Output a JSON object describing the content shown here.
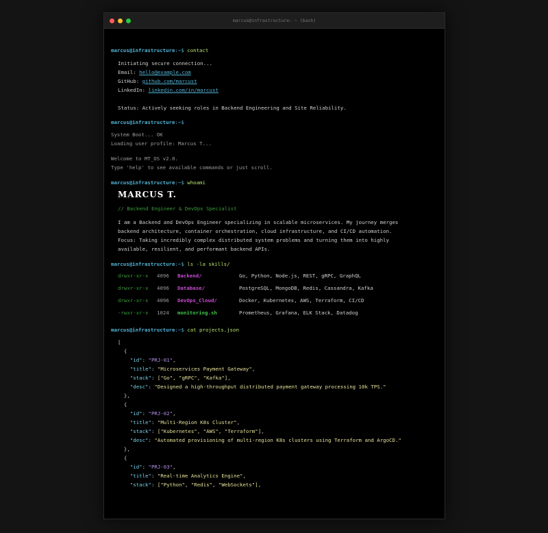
{
  "window": {
    "title": "marcus@infrastructure: ~ (bash)"
  },
  "prompt": {
    "user": "marcus@infrastructure",
    "path": ":~$"
  },
  "sections": {
    "contact": {
      "command": " contact",
      "lines": [
        "Initiating secure connection..."
      ],
      "email_label": "Email: ",
      "email": "hello@example.com",
      "github_label": "GitHub: ",
      "github": "github.com/marcust",
      "linkedin_label": "LinkedIn: ",
      "linkedin": "linkedin.com/in/marcust",
      "status": "Status: Actively seeking roles in Backend Engineering and Site Reliability."
    },
    "boot": {
      "command": "",
      "line1": "System Boot... OK",
      "line2": "Loading user profile: Marcus T...",
      "line3": "Welcome to MT_OS v2.0.",
      "line4": "Type 'help' to see available commands or just scroll."
    },
    "whoami": {
      "command": " whoami",
      "name": "MARCUS T.",
      "subtitle": "// Backend Engineer & DevOps Specialist",
      "bio": [
        "I am a Backend and DevOps Engineer specializing in scalable microservices. My journey merges",
        "backend architecture, container orchestration, cloud infrastructure, and CI/CD automation.",
        "Focus: Taking incredibly complex distributed system problems and turning them into highly",
        "available, resilient, and performant backend APIs."
      ]
    },
    "skills": {
      "command": " ls -la skills/",
      "rows": [
        {
          "perm": "drwxr-xr-x",
          "size": "4096",
          "name": "Backend/",
          "desc": "Go, Python, Node.js, REST, gRPC, GraphQL"
        },
        {
          "perm": "drwxr-xr-x",
          "size": "4096",
          "name": "Database/",
          "desc": "PostgreSQL, MongoDB, Redis, Cassandra, Kafka"
        },
        {
          "perm": "drwxr-xr-x",
          "size": "4096",
          "name": "DevOps_Cloud/",
          "desc": "Docker, Kubernetes, AWS, Terraform, CI/CD"
        },
        {
          "perm": "-rwxr-xr-x",
          "size": "1024",
          "name": "monitoring.sh",
          "desc": "Prometheus, Grafana, ELK Stack, Datadog"
        }
      ]
    },
    "projects": {
      "command": " cat projects.json",
      "items": [
        {
          "id": "PRJ-01",
          "title": "Microservices Payment Gateway",
          "stack": "[\"Go\", \"gRPC\", \"Kafka\"]",
          "desc": "Designed a high-throughput distributed payment gateway processing 10k TPS."
        },
        {
          "id": "PRJ-02",
          "title": "Multi-Region K8s Cluster",
          "stack": "[\"Kubernetes\", \"AWS\", \"Terraform\"]",
          "desc": "Automated provisioning of multi-region K8s clusters using Terraform and ArgoCD."
        },
        {
          "id": "PRJ-03",
          "title": "Real-time Analytics Engine",
          "stack": "[\"Python\", \"Redis\", \"WebSockets\"]"
        }
      ]
    }
  },
  "colors": {
    "prompt": "#52b4d6",
    "command": "#b6e36b",
    "dir": "#c84cd2",
    "file": "#3fc24a",
    "json_key": "#7ad3e8",
    "json_string": "#e6e19a",
    "json_id": "#b58fe6"
  }
}
